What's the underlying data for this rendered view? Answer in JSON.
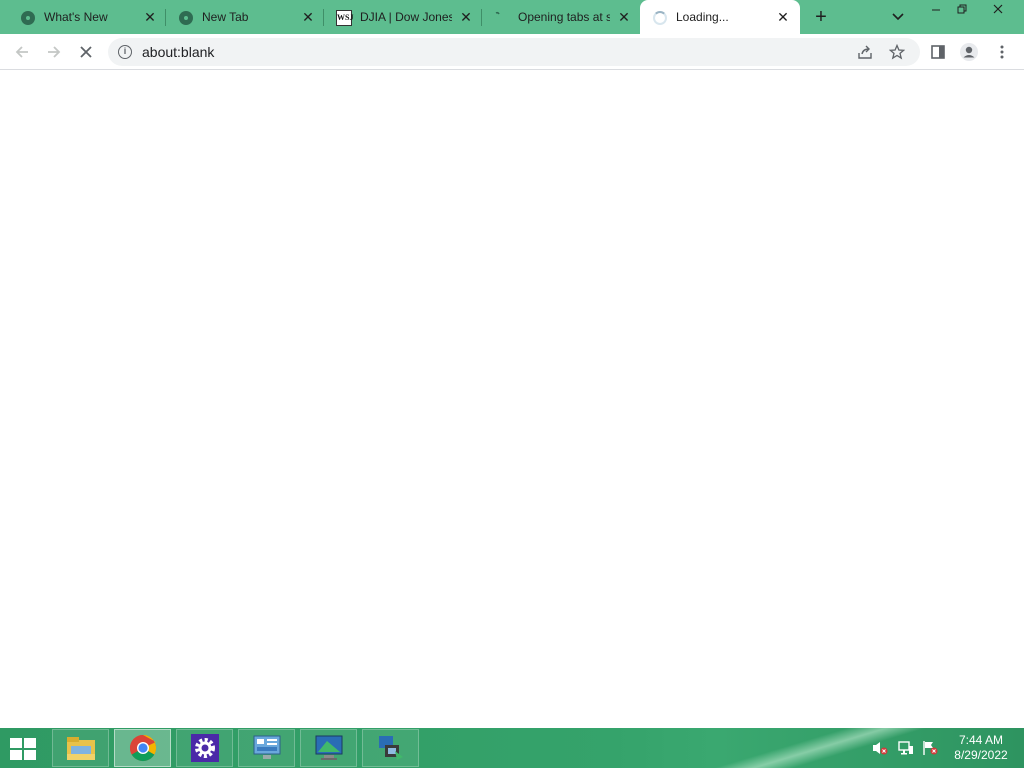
{
  "browser": {
    "tabs": [
      {
        "title": "What's New",
        "icon": "chrome-icon",
        "active": false
      },
      {
        "title": "New Tab",
        "icon": "chrome-icon",
        "active": false
      },
      {
        "title": "DJIA | Dow Jones",
        "icon": "wsj-icon",
        "favicon_text": "WSJ",
        "active": false
      },
      {
        "title": "Opening tabs at s",
        "icon": "loading-icon",
        "active": false
      },
      {
        "title": "Loading...",
        "icon": "spinner-icon",
        "active": true
      }
    ],
    "new_tab_label": "+",
    "address": "about:blank",
    "accent_color": "#5dbd8f"
  },
  "taskbar": {
    "apps": [
      {
        "name": "file-explorer-icon",
        "active": false
      },
      {
        "name": "chrome-icon",
        "active": true
      },
      {
        "name": "settings-icon",
        "active": false
      },
      {
        "name": "control-panel-icon",
        "active": false
      },
      {
        "name": "remote-desktop-icon",
        "active": false
      },
      {
        "name": "network-share-icon",
        "active": false
      }
    ],
    "time": "7:44 AM",
    "date": "8/29/2022",
    "color": "#35a36b"
  }
}
